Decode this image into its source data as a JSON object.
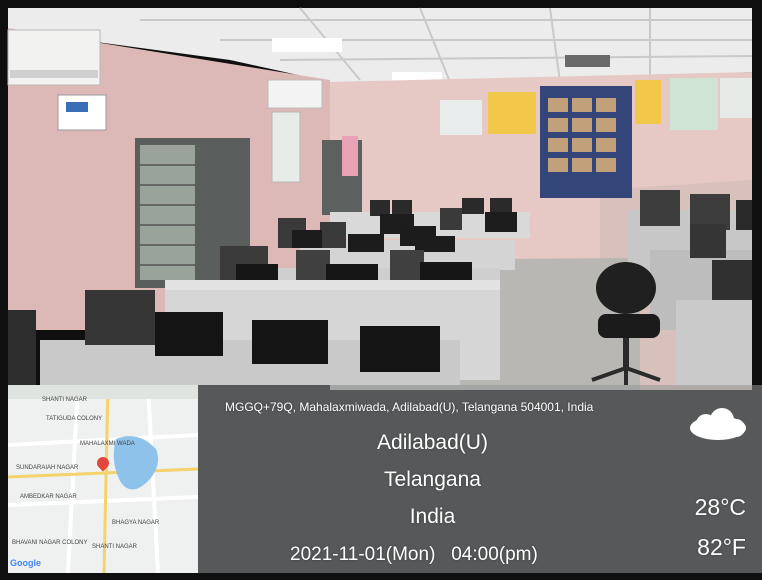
{
  "geotag": {
    "address": "MGGQ+79Q, Mahalaxmiwada, Adilabad(U), Telangana 504001, India",
    "city": "Adilabad(U)",
    "state": "Telangana",
    "country": "India",
    "datetime": "2021-11-01(Mon)   04:00(pm)",
    "temp_c": "28°C",
    "temp_f": "82°F",
    "weather_icon": "cloud-icon"
  },
  "map": {
    "logo": "Google",
    "labels": [
      "SHANTI NAGAR",
      "TATIGUDA COLONY",
      "MAHALAXMI WADA",
      "SUNDARAIAH NAGAR",
      "AMBEDKAR NAGAR",
      "BHAGYA NAGAR",
      "BHAVANI NAGAR COLONY",
      "SHANTI NAGAR"
    ],
    "pin": "location-pin-icon"
  },
  "colors": {
    "wall": "#e4c6c2",
    "ceiling": "#efefef",
    "partition": "#d2d2d2",
    "overlay": "#8f9597"
  }
}
